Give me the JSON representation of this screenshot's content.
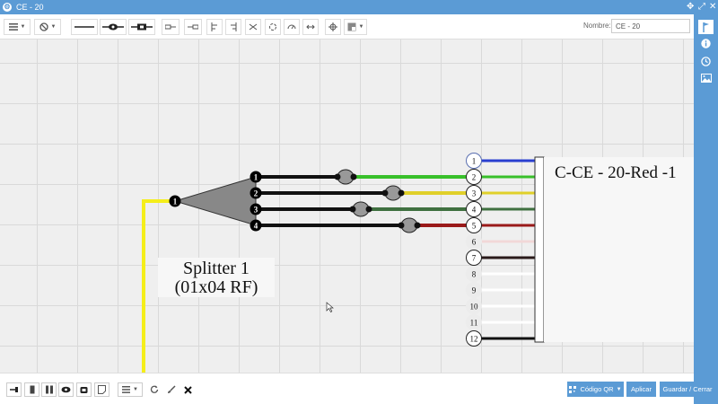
{
  "window": {
    "title": "CE - 20"
  },
  "toolbar": {
    "nombre_label": "Nombre:",
    "nombre_value": "CE - 20"
  },
  "diagram": {
    "splitter_label_line1": "Splitter 1",
    "splitter_label_line2": "(01x04 RF)",
    "splitter_input": "1",
    "splitter_outputs": [
      "1",
      "2",
      "3",
      "4"
    ],
    "cable_title": "C-CE - 20-Red -1",
    "fibers": [
      {
        "n": "1",
        "color": "#2a3fd0"
      },
      {
        "n": "2",
        "color": "#38c02a"
      },
      {
        "n": "3",
        "color": "#e0d02a"
      },
      {
        "n": "4",
        "color": "#3f7040"
      },
      {
        "n": "5",
        "color": "#9a1a1a"
      },
      {
        "n": "6",
        "color": "#f2d8d8"
      },
      {
        "n": "7",
        "color": "#2a1a1a"
      },
      {
        "n": "8",
        "color": "#ffffff"
      },
      {
        "n": "9",
        "color": "#ffffff"
      },
      {
        "n": "10",
        "color": "#ffffff"
      },
      {
        "n": "11",
        "color": "#ffffff"
      },
      {
        "n": "12",
        "color": "#111111"
      }
    ],
    "input_color": "#f5ee1a"
  },
  "bottom": {
    "qr_label": "Código QR",
    "apply_label": "Aplicar",
    "save_label": "Guardar / Cerrar"
  },
  "colors": {
    "accent": "#5b9bd5",
    "canvas": "#efefef"
  }
}
